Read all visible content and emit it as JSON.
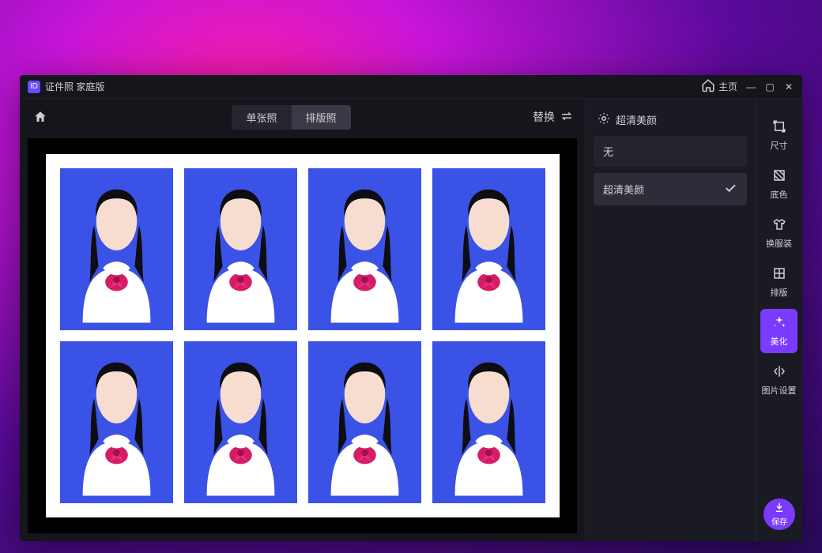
{
  "titlebar": {
    "app_title": "证件照 家庭版",
    "home_label": "主页"
  },
  "toolbar": {
    "tab_single": "单张照",
    "tab_layout": "排版照",
    "replace_label": "替换"
  },
  "right_panel": {
    "section_title": "超清美颜",
    "option_none": "无",
    "option_hd": "超清美颜"
  },
  "side_tabs": {
    "size": "尺寸",
    "bg": "底色",
    "clothes": "换服装",
    "layout": "排版",
    "beauty": "美化",
    "settings": "图片设置",
    "save": "保存"
  },
  "preview": {
    "grid_cols": 4,
    "grid_rows": 2,
    "photo_bg": "#3b52e6"
  }
}
